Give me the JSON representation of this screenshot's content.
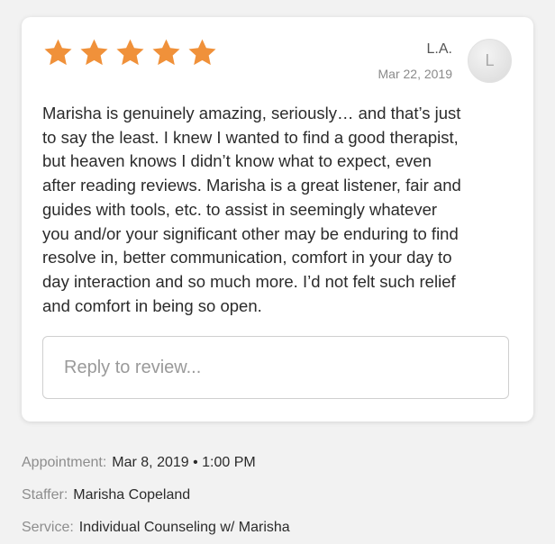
{
  "review": {
    "rating": 5,
    "max_rating": 5,
    "star_color": "#f0913a",
    "reviewer_name": "L.A.",
    "date": "Mar 22, 2019",
    "avatar_initial": "L",
    "text": "Marisha is genuinely amazing, seriously… and that’s just\nto say the least.  I knew I wanted to find a good therapist,\nbut heaven knows I didn’t know what to expect, even\nafter reading reviews.  Marisha is a great listener, fair and\nguides with tools, etc. to assist in seemingly whatever\nyou and/or your significant other may be enduring to find\nresolve in, better communication, comfort in your day to\nday interaction and so much more.  I’d not felt such relief\nand comfort in being so open.",
    "reply_placeholder": "Reply to review..."
  },
  "details": {
    "appointment_label": "Appointment:",
    "appointment_value": "Mar 8, 2019 • 1:00 PM",
    "staffer_label": "Staffer:",
    "staffer_value": "Marisha Copeland",
    "service_label": "Service:",
    "service_value": "Individual Counseling w/ Marisha"
  }
}
